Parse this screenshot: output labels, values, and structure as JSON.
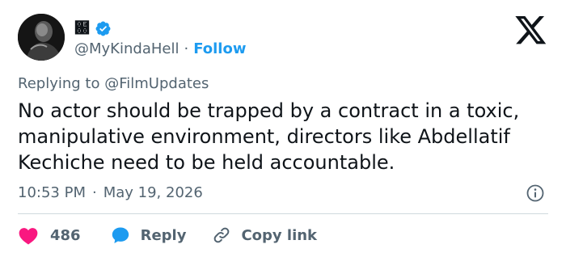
{
  "author": {
    "display_name": "฀",
    "handle": "@MyKindaHell",
    "separator": "·",
    "follow_label": "Follow",
    "verified_color": "#1d9bf0"
  },
  "reply_to": {
    "prefix": "Replying to",
    "handle": "@FilmUpdates"
  },
  "tweet": {
    "text": "No actor should be trapped by a contract in a toxic, manipulative environment, directors like Abdellatif Kechiche need to be held accountable.",
    "time": "10:53 PM",
    "date_separator": "·",
    "date": "May 19, 2026"
  },
  "actions": {
    "like_count": "486",
    "reply_label": "Reply",
    "copy_label": "Copy link"
  },
  "icons": {
    "brand": "x-logo",
    "verified": "verified-badge-icon",
    "info": "info-icon",
    "like": "heart-icon",
    "reply": "speech-bubble-icon",
    "copy": "link-icon"
  },
  "colors": {
    "accent": "#1d9bf0",
    "like": "#f91880",
    "text": "#0f1419",
    "muted": "#536471",
    "divider": "#cfd9de"
  }
}
